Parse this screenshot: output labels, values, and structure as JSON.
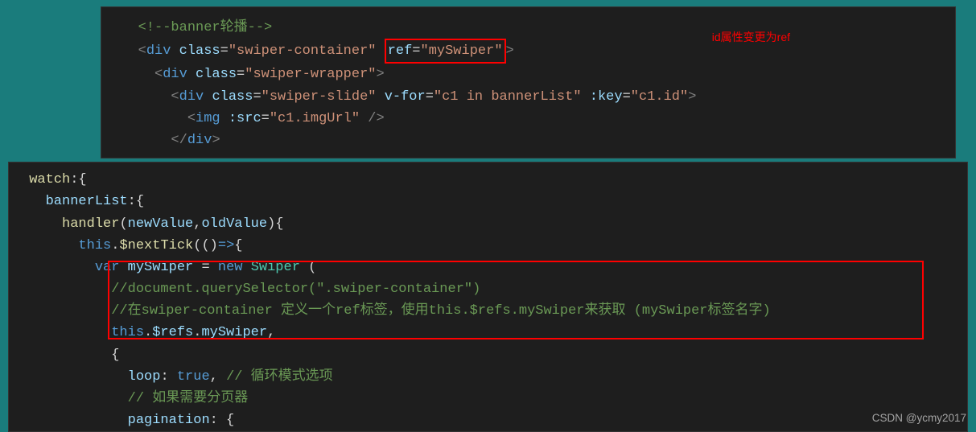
{
  "top": {
    "comment": "<!--banner轮播-->",
    "div1_open_a": "<",
    "div1_tag": "div",
    "div1_sp": " ",
    "div1_attr1": "class",
    "div1_eq": "=",
    "div1_val1": "\"swiper-container\"",
    "ref_attr": "ref",
    "ref_val": "\"mySwiper\"",
    "close": ">",
    "div2_attr": "class",
    "div2_val": "\"swiper-wrapper\"",
    "div3_attr1": "class",
    "div3_val1": "\"swiper-slide\"",
    "div3_attr2": "v-for",
    "div3_val2": "\"c1 in bannerList\"",
    "div3_attr3": ":key",
    "div3_val3": "\"c1.id\"",
    "img_tag": "img",
    "img_attr": ":src",
    "img_val": "\"c1.imgUrl\"",
    "divclose": "div"
  },
  "annotation": "id属性变更为ref",
  "bottom": {
    "l1_a": "watch",
    "l1_b": ":{",
    "l2_a": "bannerList",
    "l2_b": ":{",
    "l3_a": "handler",
    "l3_b": "(",
    "l3_c": "newValue",
    "l3_d": ",",
    "l3_e": "oldValue",
    "l3_f": "){",
    "l4_a": "this",
    "l4_b": ".",
    "l4_c": "$nextTick",
    "l4_d": "(()",
    "l4_e": "=>",
    "l4_f": "{",
    "l5_a": "var",
    "l5_b": " ",
    "l5_c": "mySwiper",
    "l5_d": " = ",
    "l5_e": "new",
    "l5_f": " ",
    "l5_g": "Swiper",
    "l5_h": " (",
    "l6": "//document.querySelector(\".swiper-container\")",
    "l7": "//在swiper-container 定义一个ref标签，使用this.$refs.mySwiper来获取 (mySwiper标签名字)",
    "l8_a": "this",
    "l8_b": ".",
    "l8_c": "$refs",
    "l8_d": ".",
    "l8_e": "mySwiper",
    "l8_f": ",",
    "l9": "{",
    "l10_a": "loop",
    "l10_b": ": ",
    "l10_c": "true",
    "l10_d": ", ",
    "l10_e": "// 循环模式选项",
    "l11": "// 如果需要分页器",
    "l12_a": "pagination",
    "l12_b": ": {"
  },
  "watermark": "CSDN @ycmy2017"
}
